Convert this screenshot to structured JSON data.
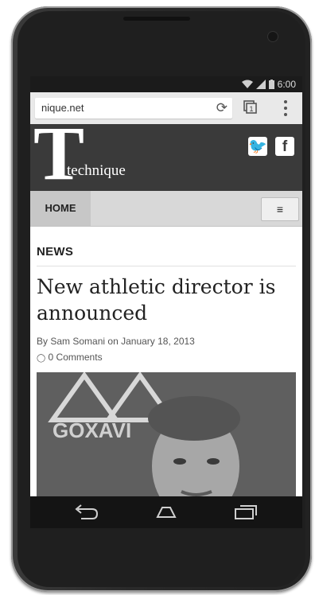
{
  "status": {
    "time": "6:00"
  },
  "browser": {
    "url": "nique.net",
    "tab_count": "1"
  },
  "site": {
    "logo_letter": "T",
    "logo_word": "technique",
    "social": [
      {
        "icon": "twitter-icon",
        "glyph": "🐦"
      },
      {
        "icon": "facebook-icon",
        "glyph": "f"
      }
    ],
    "nav": {
      "home": "HOME",
      "menu_icon": "≡"
    }
  },
  "article": {
    "section": "NEWS",
    "headline": "New athletic director is announced",
    "by": "By",
    "author": "Sam Somani",
    "on": "on",
    "date": "January 18, 2013",
    "comments_icon": "◯",
    "comments": "0 Comments",
    "photo_text": "GOXAVI"
  },
  "colors": {
    "header_bg": "#3a3a3a",
    "nav_bg": "#d8d8d8",
    "status_bg": "#1b1b1b"
  }
}
